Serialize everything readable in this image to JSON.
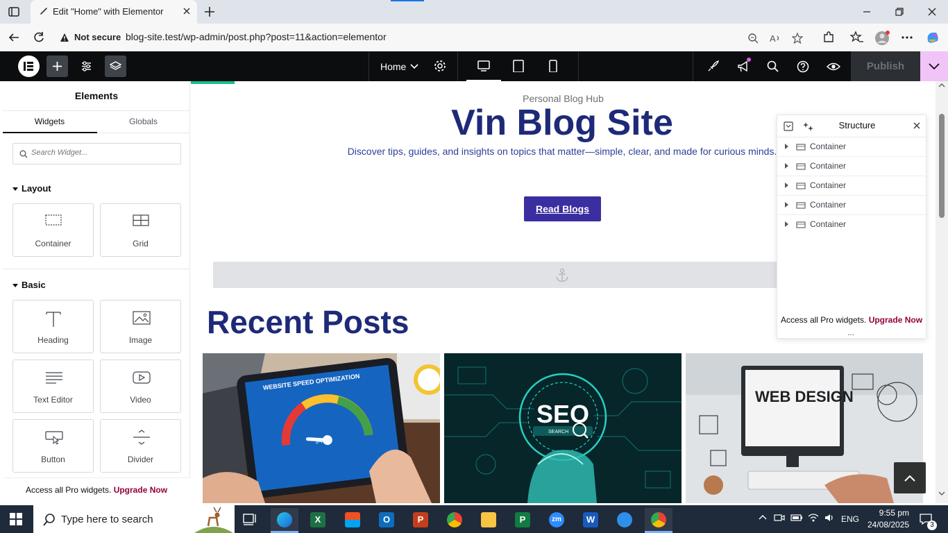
{
  "browser": {
    "tab_title": "Edit \"Home\" with Elementor",
    "security_label": "Not secure",
    "url": "blog-site.test/wp-admin/post.php?post=11&action=elementor"
  },
  "editor": {
    "page_name": "Home",
    "publish_label": "Publish",
    "devices": [
      "desktop-icon",
      "tablet-icon",
      "mobile-icon"
    ]
  },
  "panel": {
    "title": "Elements",
    "tabs": [
      "Widgets",
      "Globals"
    ],
    "active_tab": "Widgets",
    "search_placeholder": "Search Widget...",
    "sections": [
      {
        "title": "Layout",
        "widgets": [
          "Container",
          "Grid"
        ]
      },
      {
        "title": "Basic",
        "widgets": [
          "Heading",
          "Image",
          "Text Editor",
          "Video",
          "Button",
          "Divider"
        ]
      }
    ],
    "footer_text": "Access all Pro widgets.",
    "footer_link": "Upgrade Now"
  },
  "canvas": {
    "hero_subtitle": "Personal Blog Hub",
    "hero_title": "Vin Blog Site",
    "hero_desc": "Discover tips, guides, and insights on topics that matter—simple, clear, and made for curious minds.",
    "cta_label": "Read Blogs",
    "recent_title": "Recent Posts",
    "post_images": [
      "website-speed-image",
      "seo-image",
      "web-design-image"
    ],
    "speed_label": "WEBSITE SPEED OPTIMIZATION",
    "speed_value": "94 %",
    "seo_label": "SEO",
    "seo_search": "SEARCH",
    "webdesign_label": "WEB DESIGN"
  },
  "structure": {
    "title": "Structure",
    "items": [
      "Container",
      "Container",
      "Container",
      "Container",
      "Container"
    ],
    "footer_text": "Access all Pro widgets.",
    "footer_link": "Upgrade Now",
    "more": "..."
  },
  "taskbar": {
    "search_placeholder": "Type here to search",
    "lang": "ENG",
    "time": "9:55 pm",
    "date": "24/08/2025",
    "notif_count": "3"
  },
  "colors": {
    "brand_navy": "#1e2a78",
    "cta_purple": "#3b2ea0",
    "upgrade": "#93003c",
    "publish_menu": "#f0c4f6"
  }
}
